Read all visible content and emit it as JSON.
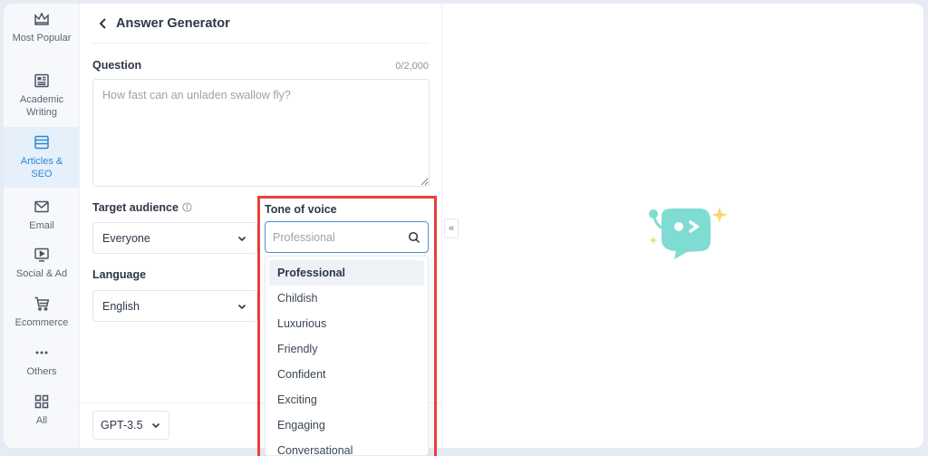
{
  "sidebar": {
    "items": [
      {
        "label": "Most Popular",
        "icon": "crown-icon"
      },
      {
        "label": "Academic Writing",
        "icon": "newspaper-icon"
      },
      {
        "label": "Articles & SEO",
        "icon": "browser-icon",
        "active": true
      },
      {
        "label": "Email",
        "icon": "mail-icon"
      },
      {
        "label": "Social & Ad",
        "icon": "play-screen-icon"
      },
      {
        "label": "Ecommerce",
        "icon": "cart-icon"
      },
      {
        "label": "Others",
        "icon": "more-dots-icon"
      },
      {
        "label": "All",
        "icon": "grid-icon"
      }
    ]
  },
  "panel": {
    "title": "Answer Generator",
    "question": {
      "label": "Question",
      "counter": "0/2,000",
      "placeholder": "How fast can an unladen swallow fly?"
    },
    "audience": {
      "label": "Target audience",
      "value": "Everyone"
    },
    "language": {
      "label": "Language",
      "value": "English"
    },
    "model": {
      "value": "GPT-3.5"
    }
  },
  "tone": {
    "label": "Tone of voice",
    "search_placeholder": "Professional",
    "options": [
      "Professional",
      "Childish",
      "Luxurious",
      "Friendly",
      "Confident",
      "Exciting",
      "Engaging",
      "Conversational"
    ],
    "selected": "Professional"
  },
  "collapse": {
    "symbol": "«"
  },
  "colors": {
    "accent": "#2f86d4",
    "highlight": "#e8403a",
    "mascot": "#7fdcd3",
    "sparkle": "#f5d76e"
  }
}
